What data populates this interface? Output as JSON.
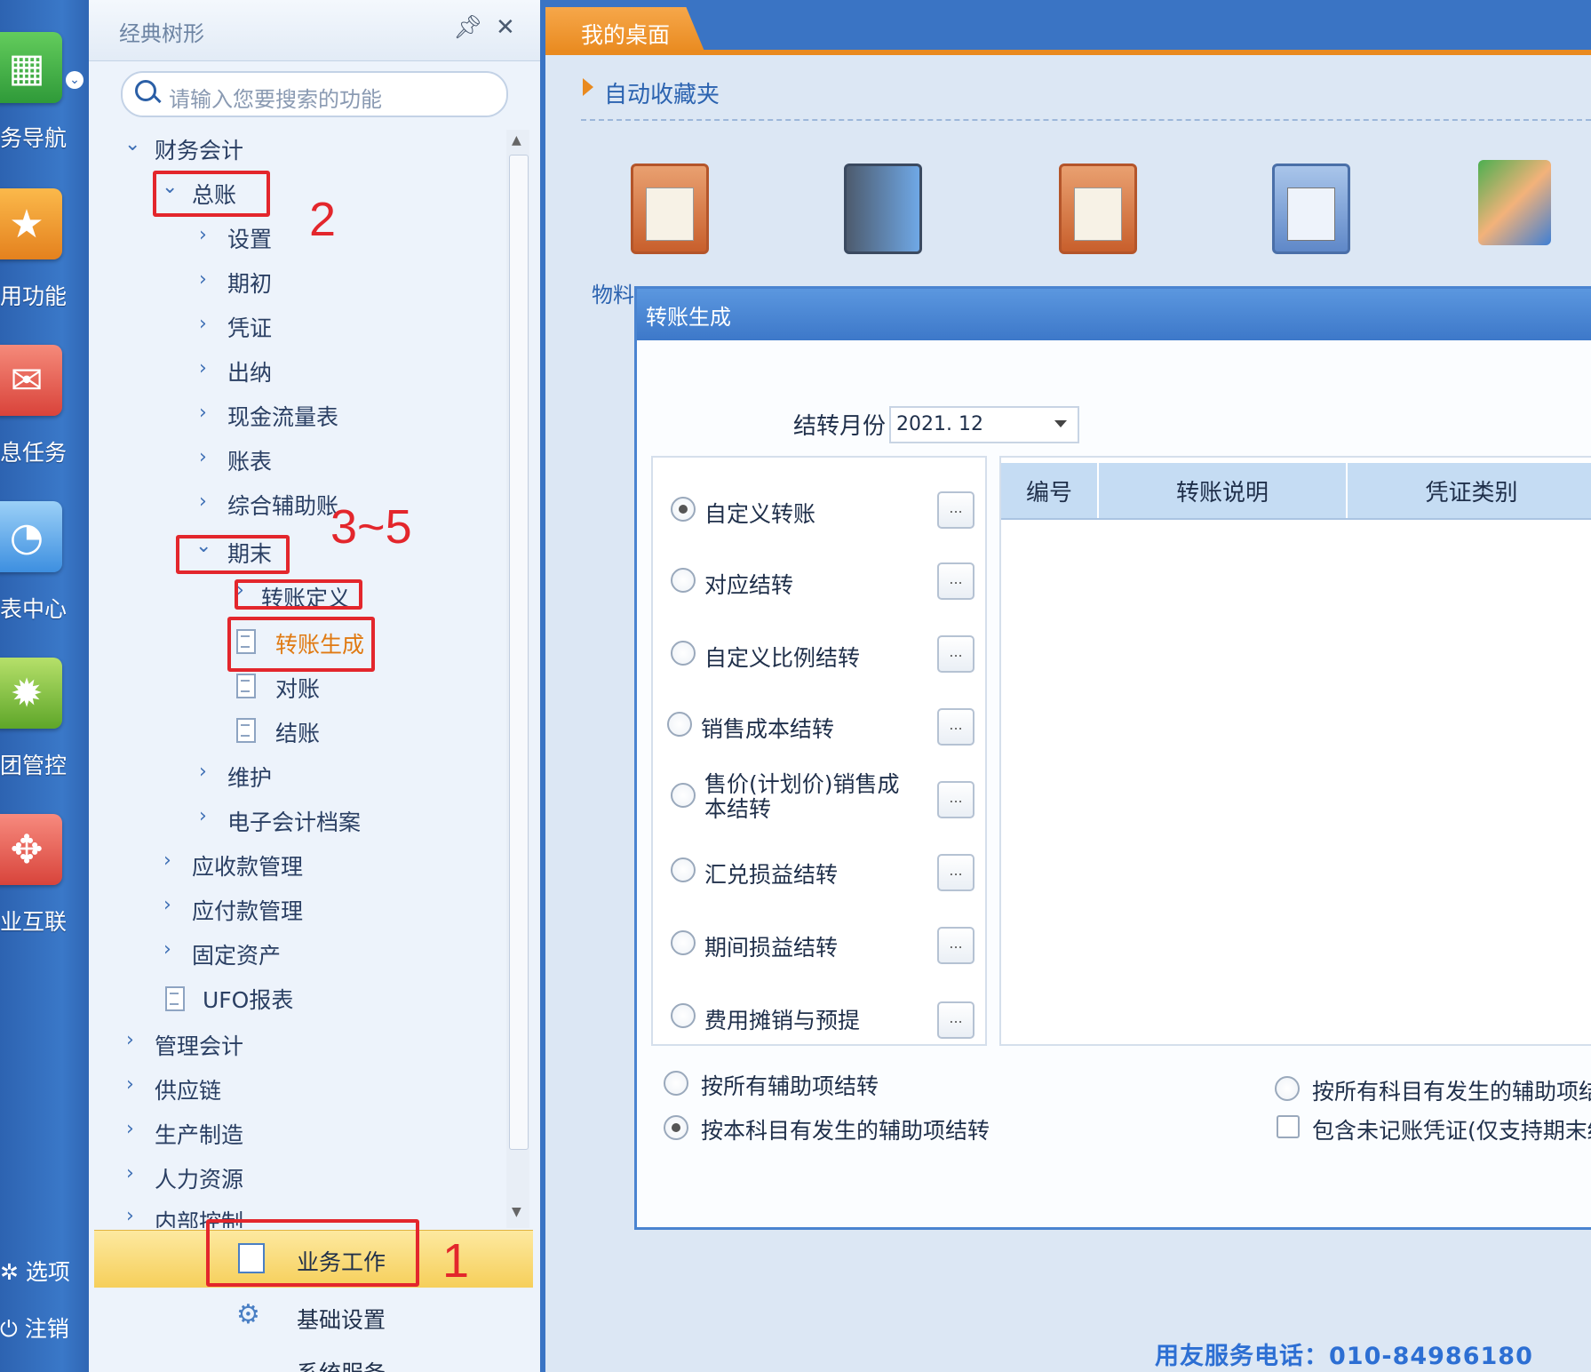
{
  "left_nav": {
    "items": [
      {
        "label": "务导航",
        "icon": "tree-icon",
        "color": "#3db04a"
      },
      {
        "label": "用功能",
        "icon": "star-folder-icon",
        "color": "#f39b2a"
      },
      {
        "label": "息任务",
        "icon": "mail-icon",
        "color": "#e95a4a"
      },
      {
        "label": "表中心",
        "icon": "report-icon",
        "color": "#3d8fe0"
      },
      {
        "label": "团管控",
        "icon": "gear-cluster-icon",
        "color": "#7cc13a"
      },
      {
        "label": "业互联",
        "icon": "connect-icon",
        "color": "#ea5a4e"
      }
    ],
    "bottom": {
      "options": "选项",
      "logout": "注销"
    }
  },
  "tree_panel": {
    "title": "经典树形",
    "search_placeholder": "请输入您要搜索的功能",
    "items": {
      "finance": "财务会计",
      "gl": "总账",
      "setup": "设置",
      "opening": "期初",
      "voucher": "凭证",
      "cashier": "出纳",
      "cashflow": "现金流量表",
      "ledger": "账表",
      "aux": "综合辅助账",
      "period_end": "期末",
      "transfer_def": "转账定义",
      "transfer_gen": "转账生成",
      "reconcile": "对账",
      "close": "结账",
      "maintain": "维护",
      "e_archive": "电子会计档案",
      "ar": "应收款管理",
      "ap": "应付款管理",
      "fixed": "固定资产",
      "ufo": "UFO报表",
      "mgmt": "管理会计",
      "supply": "供应链",
      "mfg": "生产制造",
      "hr": "人力资源",
      "internal": "内部控制"
    },
    "bottom_tabs": {
      "business": "业务工作",
      "basic": "基础设置",
      "system": "系统服务"
    }
  },
  "annotations": {
    "n1": "1",
    "n2": "2",
    "n35": "3~5"
  },
  "desktop": {
    "tab": "我的桌面",
    "favorites_title": "自动收藏夹",
    "favorites": [
      {
        "label": "物料",
        "icon": "clipboard-table-icon"
      },
      {
        "label": "",
        "icon": "books-icon"
      },
      {
        "label": "",
        "icon": "clipboard-table-icon"
      },
      {
        "label": "",
        "icon": "clipboard-grid-icon"
      },
      {
        "label": "",
        "icon": "handshake-icon"
      }
    ]
  },
  "dialog": {
    "title": "转账生成",
    "month_label": "结转月份",
    "month_value": "2021. 12",
    "options": [
      {
        "label": "自定义转账",
        "selected": true
      },
      {
        "label": "对应结转",
        "selected": false
      },
      {
        "label": "自定义比例结转",
        "selected": false
      },
      {
        "label": "销售成本结转",
        "selected": false
      },
      {
        "label": "售价(计划价)销售成",
        "label2": "本结转",
        "selected": false
      },
      {
        "label": "汇兑损益结转",
        "selected": false
      },
      {
        "label": "期间损益结转",
        "selected": false
      },
      {
        "label": "费用摊销与预提",
        "selected": false
      }
    ],
    "dots": "...",
    "grid_columns": [
      "编号",
      "转账说明",
      "凭证类别"
    ],
    "bottom_left_radio1": "按所有辅助项结转",
    "bottom_left_radio2": "按本科目有发生的辅助项结转",
    "bottom_right_radio": "按所有科目有发生的辅助项结",
    "bottom_right_check": "包含未记账凭证(仅支持期末结"
  },
  "footer_phone": "用友服务电话：010-84986180",
  "colors": {
    "accent": "#3a74c4",
    "tab_orange": "#e98a1f",
    "highlight_red": "#e3262c",
    "link_blue": "#2b63b0"
  }
}
